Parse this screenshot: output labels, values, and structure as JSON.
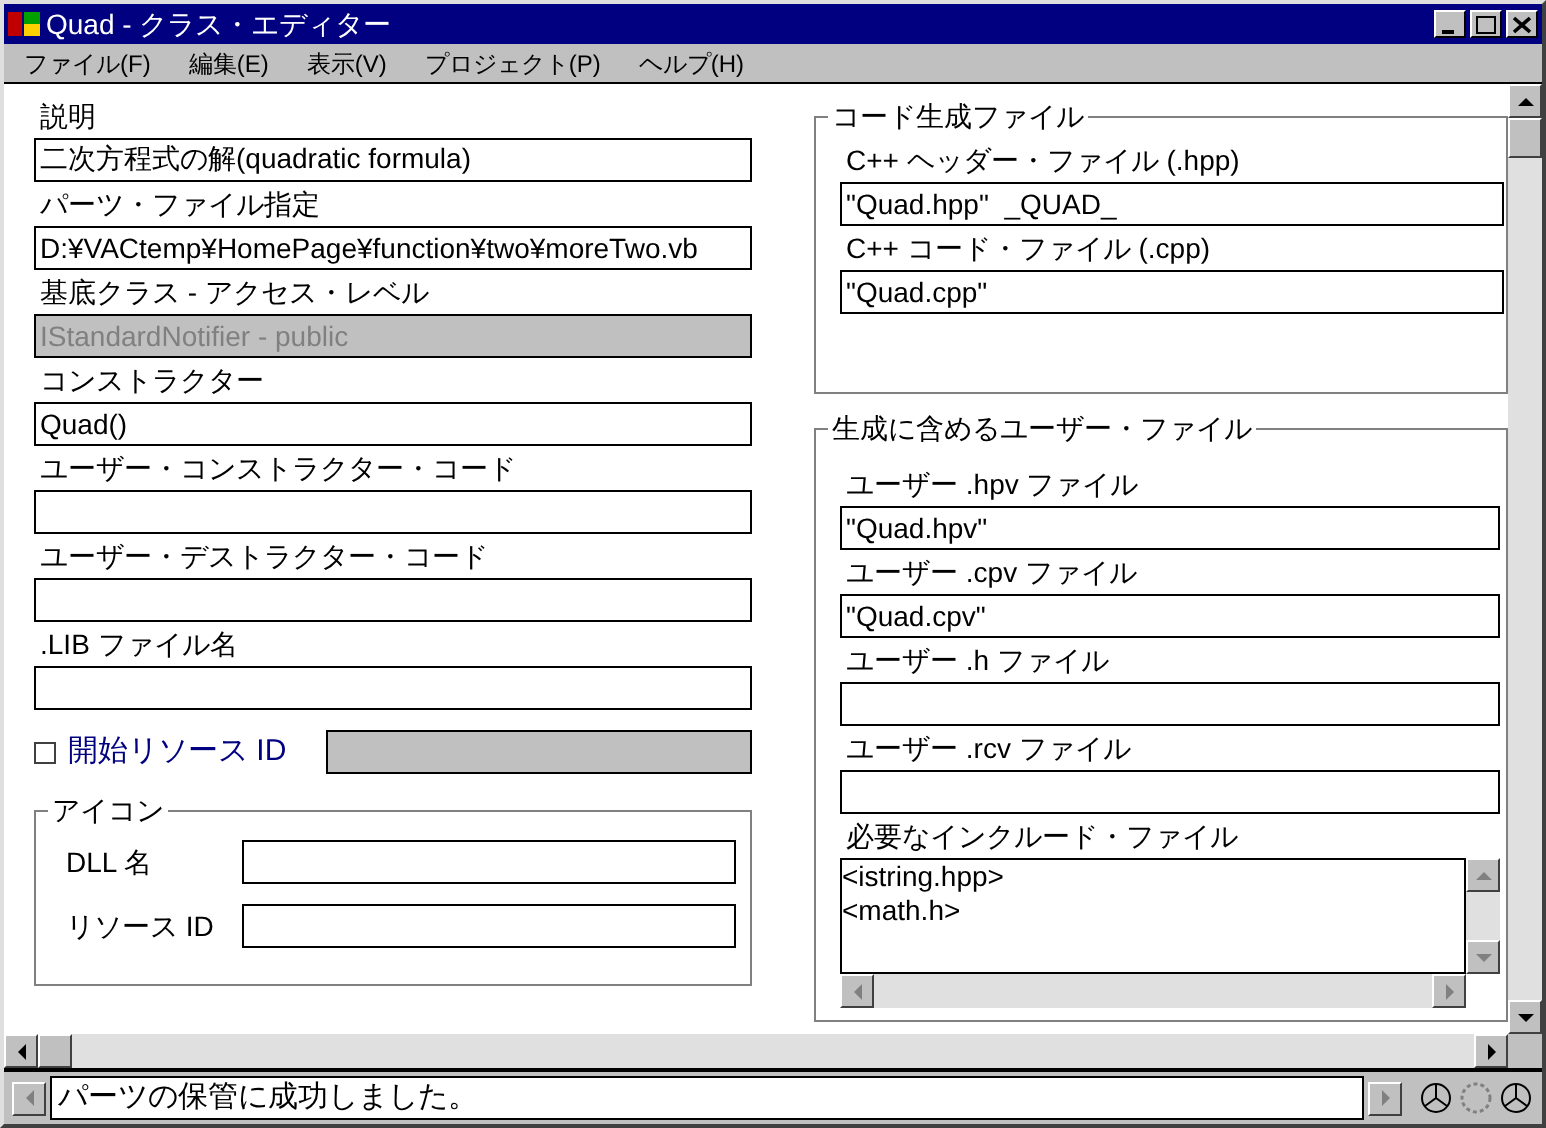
{
  "window": {
    "title": "Quad - クラス・エディター"
  },
  "menu": [
    "ファイル(F)",
    "編集(E)",
    "表示(V)",
    "プロジェクト(P)",
    "ヘルプ(H)"
  ],
  "fields_left": [
    {
      "label": "説明",
      "value": "二次方程式の解(quadratic formula)",
      "disabled": false
    },
    {
      "label": "パーツ・ファイル指定",
      "value": "D:¥VACtemp¥HomePage¥function¥two¥moreTwo.vb",
      "disabled": false
    },
    {
      "label": "基底クラス - アクセス・レベル",
      "value": "IStandardNotifier - public",
      "disabled": true
    },
    {
      "label": "コンストラクター",
      "value": "Quad()",
      "disabled": false
    },
    {
      "label": "ユーザー・コンストラクター・コード",
      "disabled": false
    },
    {
      "label": "ユーザー・デストラクター・コード",
      "disabled": false
    },
    {
      "label": ".LIB ファイル名",
      "disabled": false
    }
  ],
  "start_resource": {
    "label": "開始リソース ID",
    "checked": false
  },
  "icon_group": {
    "title": "アイコン",
    "fields": [
      {
        "label": "DLL 名"
      },
      {
        "label": "リソース ID"
      }
    ]
  },
  "code_group": {
    "title": "コード生成ファイル",
    "fields": [
      {
        "label": "C++ ヘッダー・ファイル (.hpp)",
        "value": "\"Quad.hpp\"  _QUAD_"
      },
      {
        "label": "C++ コード・ファイル (.cpp)",
        "value": "\"Quad.cpp\""
      }
    ]
  },
  "user_group": {
    "title": "生成に含めるユーザー・ファイル",
    "fields": [
      {
        "label": "ユーザー .hpv ファイル",
        "value": "\"Quad.hpv\""
      },
      {
        "label": "ユーザー .cpv ファイル",
        "value": "\"Quad.cpv\""
      },
      {
        "label": "ユーザー .h ファイル"
      },
      {
        "label": "ユーザー .rcv ファイル"
      }
    ],
    "includes": {
      "label": "必要なインクルード・ファイル",
      "lines": [
        "<istring.hpp>",
        "<math.h>"
      ]
    }
  },
  "status_bar": {
    "message": "パーツの保管に成功しました。"
  }
}
